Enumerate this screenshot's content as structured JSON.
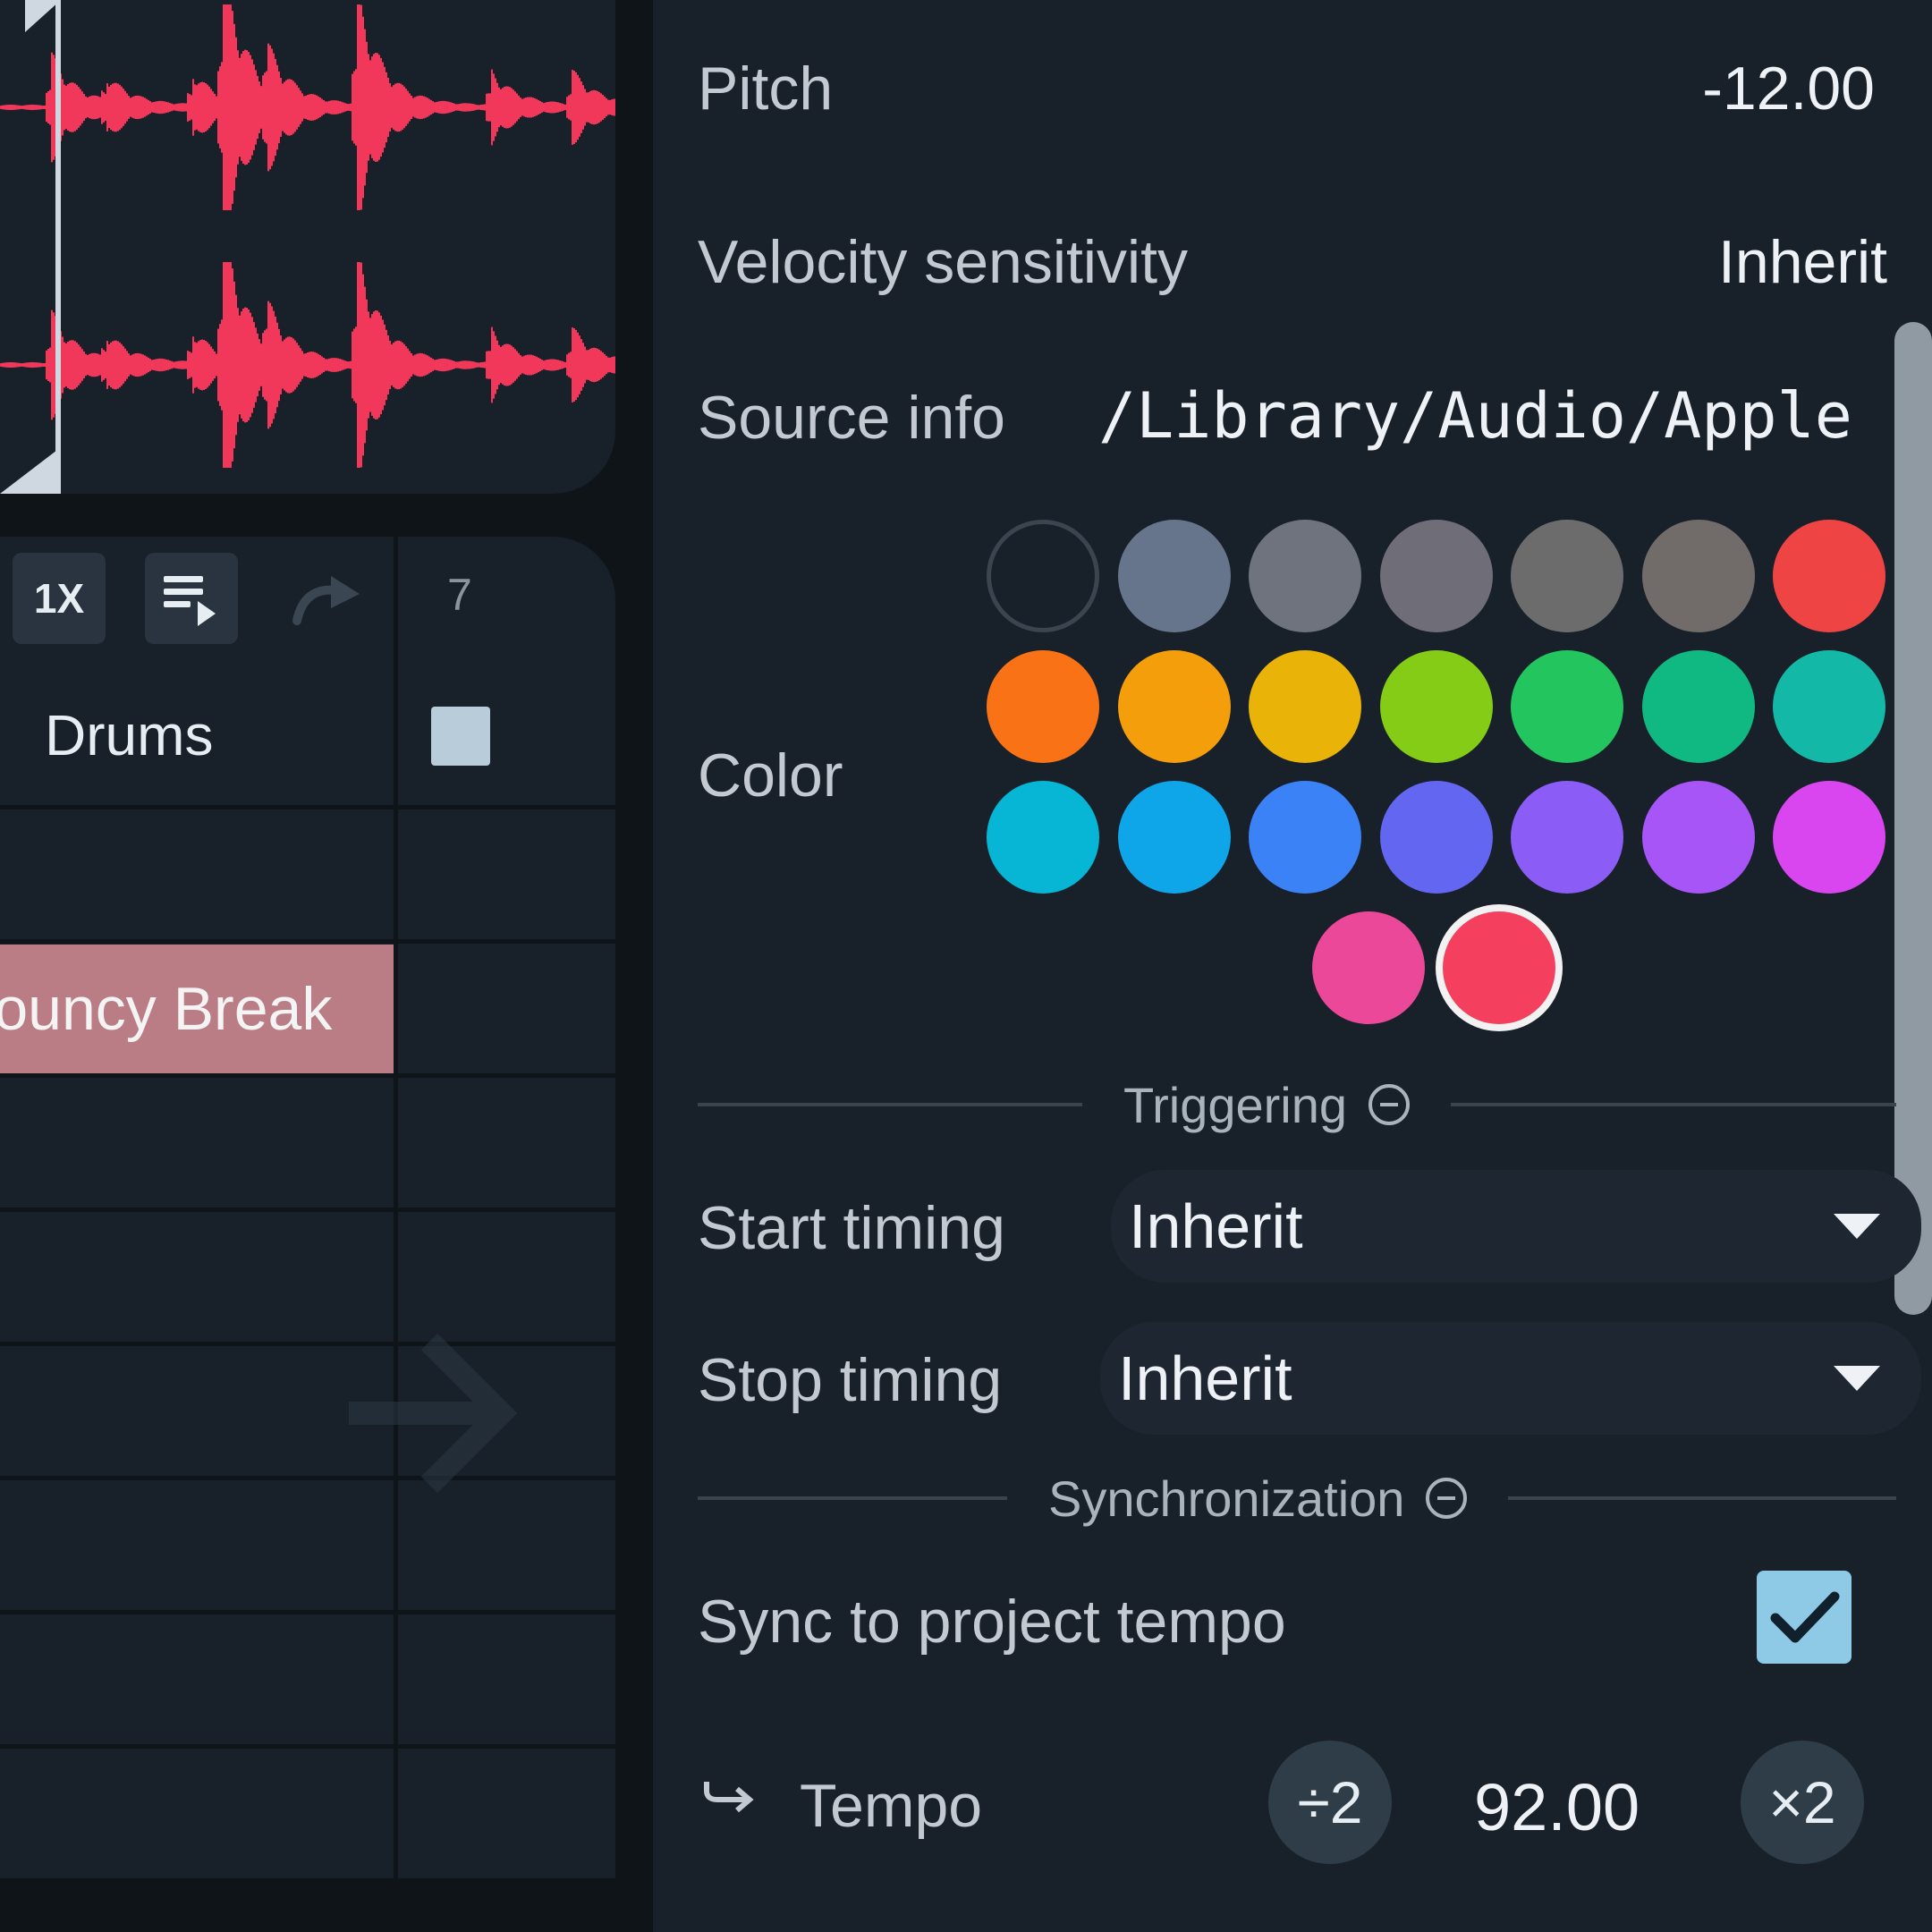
{
  "clip_panel": {
    "speed_label": "1X",
    "column_number": "7",
    "track_name": "Drums",
    "clip_name": "Bouncy Break",
    "waveform_color": "#f2385a"
  },
  "properties": {
    "pitch": {
      "label": "Pitch",
      "value": "-12.00"
    },
    "velocity": {
      "label": "Velocity sensitivity",
      "value": "Inherit"
    },
    "source": {
      "label": "Source info",
      "value": "/Library/Audio/Apple"
    },
    "color": {
      "label": "Color",
      "swatches": [
        "none",
        "#66758c",
        "#6e737e",
        "#6f6d78",
        "#6d6c6c",
        "#716c69",
        "#ef4444",
        "#f97316",
        "#f59e0b",
        "#eab308",
        "#84cc16",
        "#22c55e",
        "#10b981",
        "#14b8a6",
        "#06b6d4",
        "#0ea5e9",
        "#3b82f6",
        "#6366f1",
        "#8b5cf6",
        "#a855f7",
        "#d946ef",
        "#ec4899",
        "#f43f5e"
      ],
      "selected_index": 22
    },
    "triggering": {
      "title": "Triggering",
      "start_timing": {
        "label": "Start timing",
        "value": "Inherit"
      },
      "stop_timing": {
        "label": "Stop timing",
        "value": "Inherit"
      }
    },
    "synchronization": {
      "title": "Synchronization",
      "sync_label": "Sync to project tempo",
      "sync_checked": true,
      "tempo_label": "Tempo",
      "tempo_value": "92.00",
      "halve_label": "÷2",
      "double_label": "×2"
    }
  }
}
